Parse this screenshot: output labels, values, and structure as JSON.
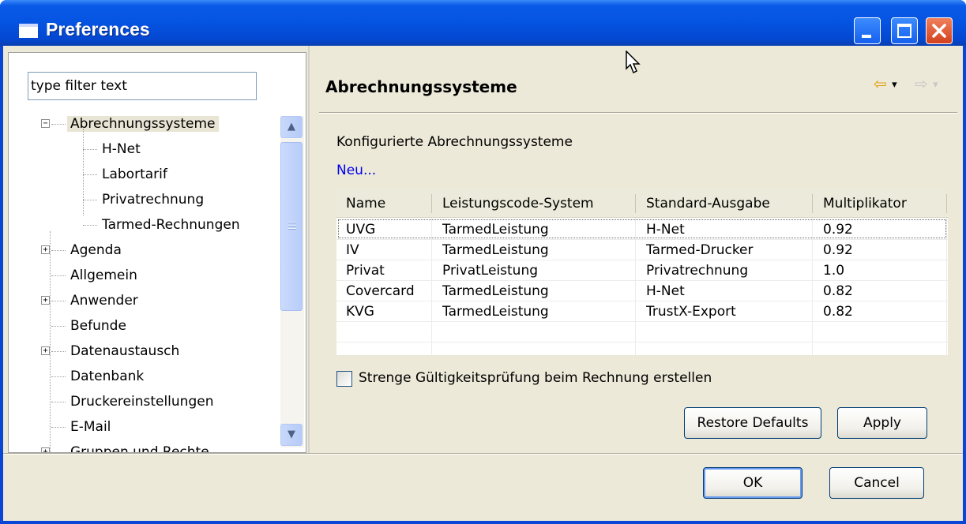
{
  "window": {
    "title": "Preferences",
    "controls": {
      "minimize": "minimize",
      "maximize": "maximize",
      "close": "close"
    }
  },
  "filter": {
    "placeholder": "type filter text",
    "value": "type filter text"
  },
  "tree": {
    "items": [
      {
        "label": "Abrechnungssysteme",
        "expanded": true,
        "selected": true
      },
      {
        "label": "H-Net",
        "child": true
      },
      {
        "label": "Labortarif",
        "child": true
      },
      {
        "label": "Privatrechnung",
        "child": true
      },
      {
        "label": "Tarmed-Rechnungen",
        "child": true
      },
      {
        "label": "Agenda",
        "expandable": true
      },
      {
        "label": "Allgemein"
      },
      {
        "label": "Anwender",
        "expandable": true
      },
      {
        "label": "Befunde"
      },
      {
        "label": "Datenaustausch",
        "expandable": true
      },
      {
        "label": "Datenbank"
      },
      {
        "label": "Druckereinstellungen"
      },
      {
        "label": "E-Mail"
      },
      {
        "label": "Gruppen und Rechte",
        "expandable": true
      }
    ]
  },
  "page": {
    "title": "Abrechnungssysteme",
    "section_label": "Konfigurierte Abrechnungssysteme",
    "new_link": "Neu...",
    "nav": {
      "back": "⇦",
      "forward": "⇨",
      "dropdown": "▾"
    }
  },
  "table": {
    "columns": [
      "Name",
      "Leistungscode-System",
      "Standard-Ausgabe",
      "Multiplikator"
    ],
    "rows": [
      [
        "UVG",
        "TarmedLeistung",
        "H-Net",
        "0.92"
      ],
      [
        "IV",
        "TarmedLeistung",
        "Tarmed-Drucker",
        "0.92"
      ],
      [
        "Privat",
        "PrivatLeistung",
        "Privatrechnung",
        "1.0"
      ],
      [
        "Covercard",
        "TarmedLeistung",
        "H-Net",
        "0.82"
      ],
      [
        "KVG",
        "TarmedLeistung",
        "TrustX-Export",
        "0.82"
      ]
    ]
  },
  "checkbox": {
    "label": "Strenge Gültigkeitsprüfung beim Rechnung erstellen",
    "checked": false
  },
  "buttons": {
    "restore": "Restore Defaults",
    "apply": "Apply",
    "ok": "OK",
    "cancel": "Cancel"
  },
  "colors": {
    "titlebar": "#0553e1",
    "dialog": "#ece9d8",
    "link": "#0000ee"
  }
}
